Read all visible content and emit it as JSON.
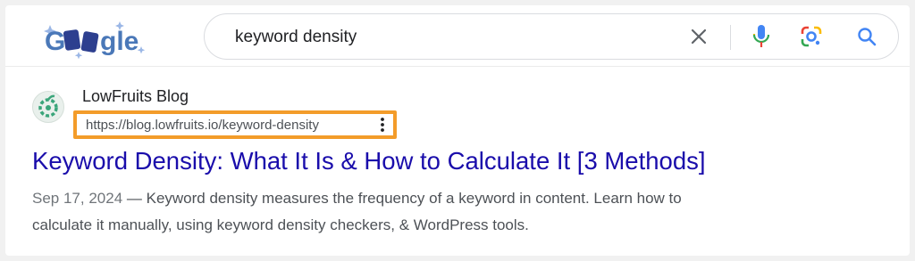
{
  "logo": {
    "text": "Google",
    "colors": {
      "letters": "#4a78b8",
      "tiles": "#2d3f8f",
      "sparkles": "#9bb7e6"
    }
  },
  "search": {
    "query": "keyword density",
    "icons": [
      "close-icon",
      "microphone-icon",
      "google-lens-icon",
      "search-icon"
    ]
  },
  "result": {
    "site_name": "LowFruits Blog",
    "url": "https://blog.lowfruits.io/keyword-density",
    "title": "Keyword Density: What It Is & How to Calculate It [3 Methods]",
    "date": "Sep 17, 2024",
    "separator": " — ",
    "snippet_line1": "Keyword density measures the frequency of a keyword in content. Learn how to",
    "snippet_line2": "calculate it manually, using keyword density checkers, & WordPress tools."
  },
  "colors": {
    "title": "#1a0dab",
    "highlight": "#f39c2a",
    "favicon": "#3aa57a"
  }
}
